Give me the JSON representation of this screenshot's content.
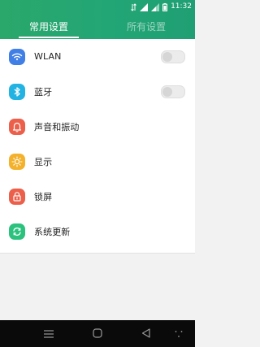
{
  "status_bar": {
    "time": "11:32",
    "icons": [
      "data-arrows-icon",
      "signal-icon",
      "signal-icon-2",
      "battery-icon"
    ]
  },
  "tabs": [
    {
      "label": "常用设置",
      "active": true
    },
    {
      "label": "所有设置",
      "active": false
    }
  ],
  "settings": {
    "items": [
      {
        "label": "WLAN",
        "icon": "wifi-icon",
        "icon_color": "#3f7fe6",
        "toggle": true,
        "toggle_state": "off"
      },
      {
        "label": "蓝牙",
        "icon": "bluetooth-icon",
        "icon_color": "#22b3e3",
        "toggle": true,
        "toggle_state": "off"
      },
      {
        "label": "声音和振动",
        "icon": "bell-icon",
        "icon_color": "#ec5f4a",
        "toggle": false
      },
      {
        "label": "显示",
        "icon": "sun-icon",
        "icon_color": "#f4b12b",
        "toggle": false
      },
      {
        "label": "锁屏",
        "icon": "lock-icon",
        "icon_color": "#ec5f4a",
        "toggle": false
      },
      {
        "label": "系统更新",
        "icon": "refresh-icon",
        "icon_color": "#2bc27d",
        "toggle": false
      }
    ]
  },
  "nav": {
    "buttons": [
      "menu-icon",
      "home-icon",
      "back-icon",
      "more-icon"
    ]
  },
  "colors": {
    "header": "#23a676",
    "nav_bar": "#0a0a0a",
    "list_background": "#ffffff",
    "page_background": "#f2f2f2"
  }
}
